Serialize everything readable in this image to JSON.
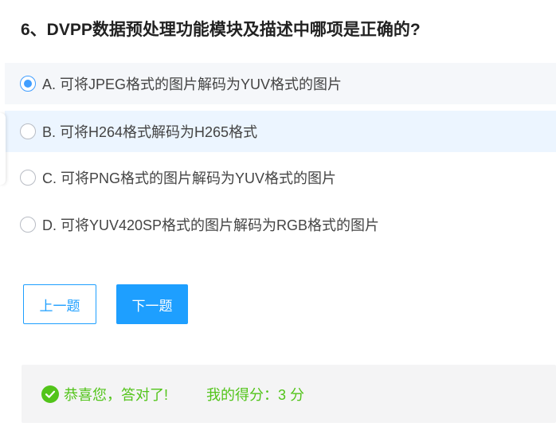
{
  "question": {
    "title": "6、DVPP数据预处理功能模块及描述中哪项是正确的?"
  },
  "options": [
    {
      "label": "A. 可将JPEG格式的图片解码为YUV格式的图片",
      "checked": true
    },
    {
      "label": "B. 可将H264格式解码为H265格式",
      "checked": false
    },
    {
      "label": "C. 可将PNG格式的图片解码为YUV格式的图片",
      "checked": false
    },
    {
      "label": "D. 可将YUV420SP格式的图片解码为RGB格式的图片",
      "checked": false
    }
  ],
  "buttons": {
    "prev_label": "上一题",
    "next_label": "下一题"
  },
  "result": {
    "message": "恭喜您，答对了!",
    "score_text": "我的得分：3 分"
  },
  "colors": {
    "accent": "#1e9fff",
    "radio_checked": "#409eff",
    "success": "#52c41a"
  },
  "icons": {
    "result": "check-circle-icon"
  }
}
